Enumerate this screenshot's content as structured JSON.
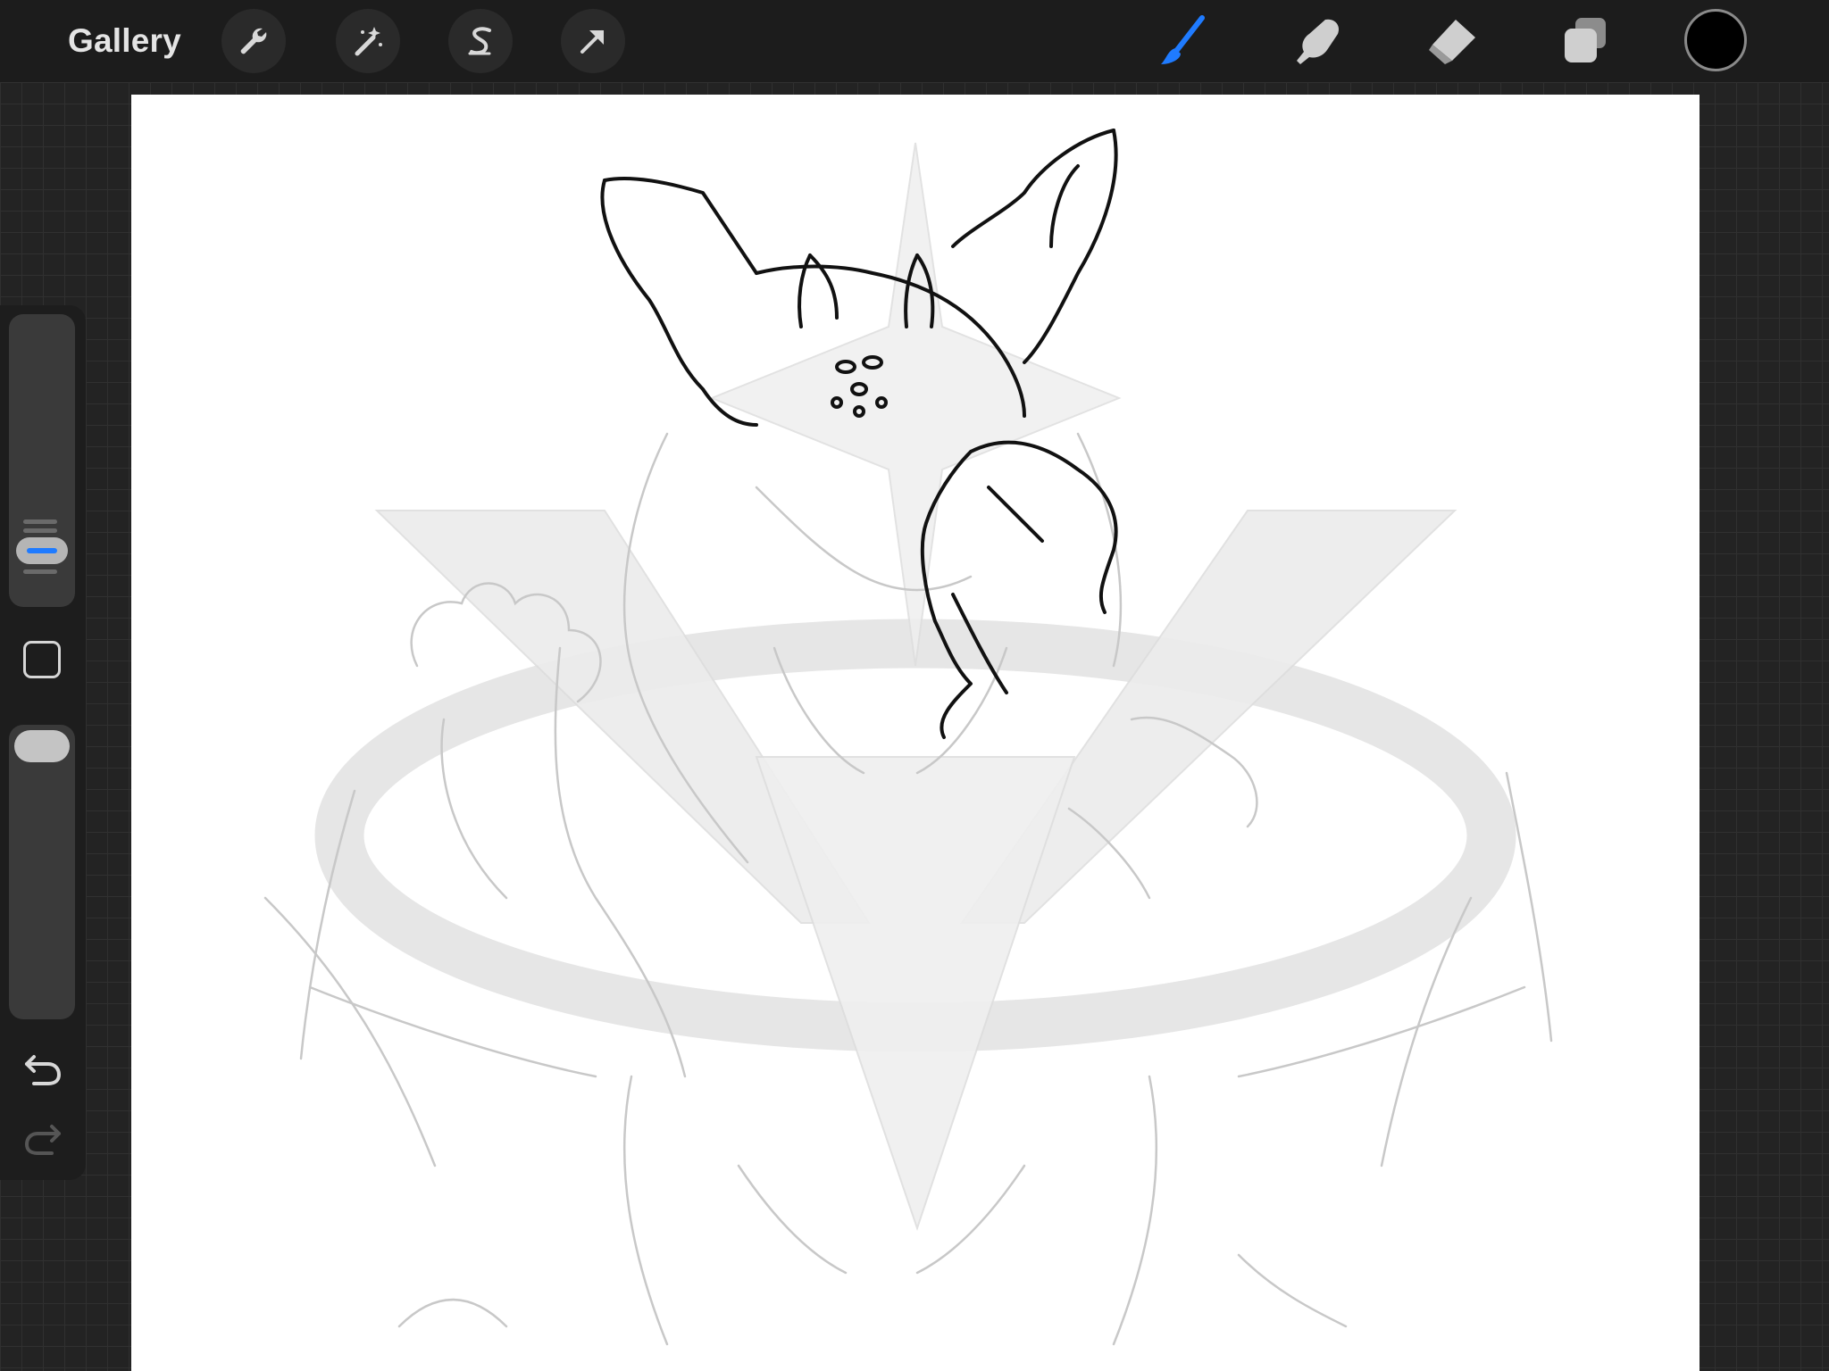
{
  "topbar": {
    "gallery_label": "Gallery",
    "left_tools": [
      {
        "name": "actions",
        "icon": "wrench-icon"
      },
      {
        "name": "adjustments",
        "icon": "magic-wand-icon"
      },
      {
        "name": "selection",
        "icon": "selection-s-icon"
      },
      {
        "name": "transform",
        "icon": "arrow-cursor-icon"
      }
    ],
    "right_tools": [
      {
        "name": "brush",
        "icon": "brush-icon",
        "active": true
      },
      {
        "name": "smudge",
        "icon": "smudge-finger-icon",
        "active": false
      },
      {
        "name": "eraser",
        "icon": "eraser-icon",
        "active": false
      },
      {
        "name": "layers",
        "icon": "layers-icon",
        "active": false
      }
    ],
    "current_color": "#000000"
  },
  "sidebar": {
    "brush_size_icon": "brush-size-slider",
    "modify_icon": "square-modify-icon",
    "opacity_icon": "opacity-slider",
    "undo_icon": "undo-arrow-icon",
    "redo_icon": "redo-arrow-icon"
  },
  "colors": {
    "accent": "#1f7bff",
    "topbar_bg": "#1c1c1c",
    "canvas_bg": "#ffffff"
  }
}
